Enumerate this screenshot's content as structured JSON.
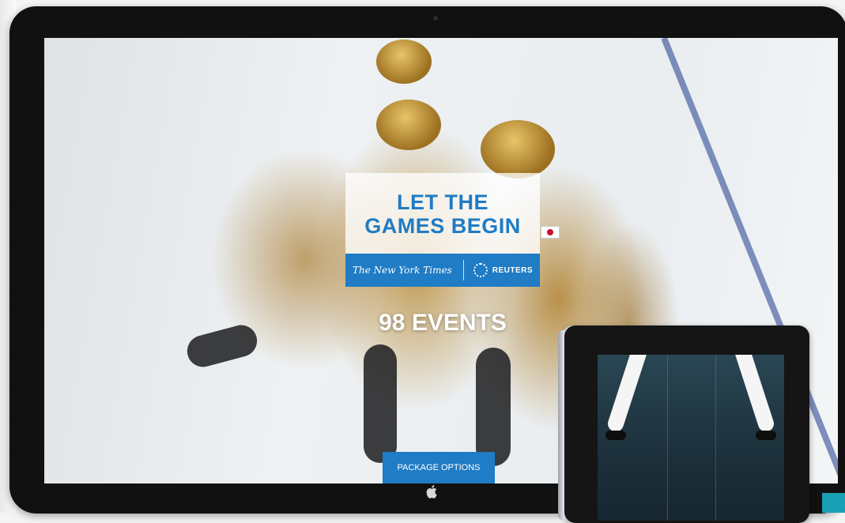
{
  "screen": {
    "headline_line1": "LET THE",
    "headline_line2": "GAMES BEGIN",
    "partners": {
      "nyt_logo_text": "The New York Times",
      "reuters_logo_text": "REUTERS"
    },
    "events_text": "98 EVENTS",
    "cta_label": "PACKAGE OPTIONS"
  },
  "colors": {
    "brand_blue": "#1f7cc5",
    "teal_accent": "#1aa0b4"
  },
  "icons": [
    "apple-icon",
    "reuters-icon",
    "camera-icon"
  ]
}
